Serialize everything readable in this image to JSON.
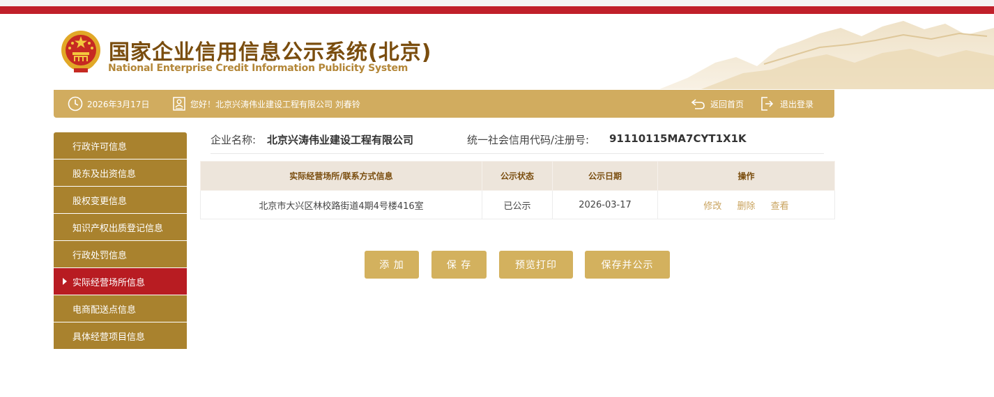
{
  "header": {
    "title_cn": "国家企业信用信息公示系统(北京)",
    "title_en": "National Enterprise Credit Information Publicity System"
  },
  "infobar": {
    "date": "2026年3月17日",
    "greeting": "您好！北京兴涛伟业建设工程有限公司  刘春铃",
    "home_label": "返回首页",
    "logout_label": "退出登录"
  },
  "sidebar": {
    "items": [
      {
        "label": "行政许可信息"
      },
      {
        "label": "股东及出资信息"
      },
      {
        "label": "股权变更信息"
      },
      {
        "label": "知识产权出质登记信息"
      },
      {
        "label": "行政处罚信息"
      },
      {
        "label": "实际经营场所信息",
        "active": true
      },
      {
        "label": "电商配送点信息"
      },
      {
        "label": "具体经营项目信息"
      }
    ]
  },
  "company": {
    "name_label": "企业名称:",
    "name_value": "北京兴涛伟业建设工程有限公司",
    "code_label": "统一社会信用代码/注册号:",
    "code_value": "91110115MA7CYT1X1K"
  },
  "table": {
    "headers": [
      "实际经营场所/联系方式信息",
      "公示状态",
      "公示日期",
      "操作"
    ],
    "rows": [
      {
        "address": "北京市大兴区林校路街道4期4号楼416室",
        "status": "已公示",
        "date": "2026-03-17",
        "ops": [
          "修改",
          "删除",
          "查看"
        ]
      }
    ]
  },
  "buttons": {
    "add": "添 加",
    "save": "保 存",
    "preview": "预览打印",
    "save_publish": "保存并公示"
  },
  "colors": {
    "brand_red": "#c0202a",
    "gold_bar": "#d1ac5f",
    "sidebar_gold": "#a9822e",
    "sidebar_active": "#b81c22",
    "button_gold": "#d3b15e",
    "title_brown": "#7a4d0e"
  },
  "icons": {
    "emblem": "national-emblem",
    "date": "clock-icon",
    "user": "user-card-icon",
    "home": "return-arrow-icon",
    "logout": "logout-icon"
  }
}
